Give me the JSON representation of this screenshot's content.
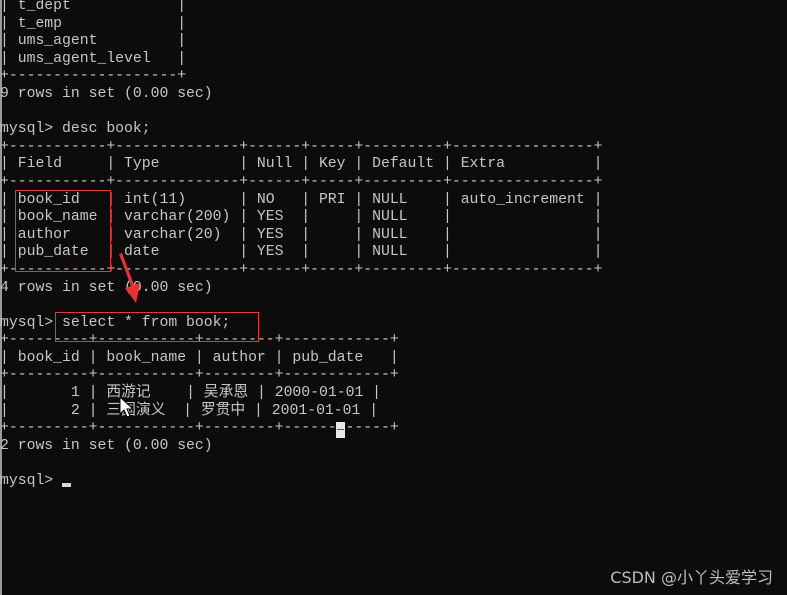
{
  "terminal": {
    "prev_table": {
      "rows": [
        "t_dept",
        "t_emp",
        "ums_agent",
        "ums_agent_level"
      ],
      "footer": "9 rows in set (0.00 sec)"
    },
    "prompt": "mysql> ",
    "cmd1": "desc book;",
    "desc_table": {
      "headers": [
        "Field",
        "Type",
        "Null",
        "Key",
        "Default",
        "Extra"
      ],
      "rows": [
        [
          "book_id",
          "int(11)",
          "NO",
          "PRI",
          "NULL",
          "auto_increment"
        ],
        [
          "book_name",
          "varchar(200)",
          "YES",
          "",
          "NULL",
          ""
        ],
        [
          "author",
          "varchar(20)",
          "YES",
          "",
          "NULL",
          ""
        ],
        [
          "pub_date",
          "date",
          "YES",
          "",
          "NULL",
          ""
        ]
      ],
      "footer": "4 rows in set (0.00 sec)"
    },
    "cmd2": "select * from book;",
    "select_table": {
      "headers": [
        "book_id",
        "book_name",
        "author",
        "pub_date"
      ],
      "rows": [
        [
          "1",
          "西游记",
          "吴承恩",
          "2000-01-01"
        ],
        [
          "2",
          "三国演义",
          "罗贯中",
          "2001-01-01"
        ]
      ],
      "footer": "2 rows in set (0.00 sec)"
    }
  },
  "annotations": {
    "highlight_color": "#e03a3a"
  },
  "watermark": "CSDN @小丫头爱学习"
}
